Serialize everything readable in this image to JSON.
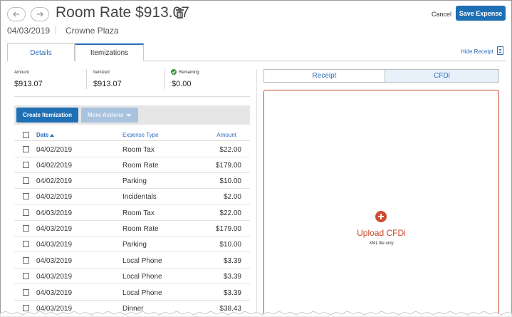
{
  "header": {
    "title": "Room Rate $913.07",
    "date": "04/03/2019",
    "vendor": "Crowne Plaza",
    "cancel_label": "Cancel",
    "save_label": "Save Expense"
  },
  "tabs": [
    {
      "label": "Details",
      "active": false
    },
    {
      "label": "Itemizations",
      "active": true
    }
  ],
  "hide_receipt_label": "Hide Receipt",
  "summary": {
    "amount_label": "Amount",
    "amount_value": "$913.07",
    "itemized_label": "Itemized",
    "itemized_value": "$913.07",
    "remaining_label": "Remaining",
    "remaining_value": "$0.00"
  },
  "toolbar": {
    "create_label": "Create Itemization",
    "more_label": "More Actions"
  },
  "table": {
    "columns": {
      "date": "Date",
      "type": "Expense Type",
      "amount": "Amount"
    },
    "rows": [
      {
        "date": "04/02/2019",
        "type": "Room Tax",
        "amount": "$22.00"
      },
      {
        "date": "04/02/2019",
        "type": "Room Rate",
        "amount": "$179.00"
      },
      {
        "date": "04/02/2019",
        "type": "Parking",
        "amount": "$10.00"
      },
      {
        "date": "04/02/2019",
        "type": "Incidentals",
        "amount": "$2.00"
      },
      {
        "date": "04/03/2019",
        "type": "Room Tax",
        "amount": "$22.00"
      },
      {
        "date": "04/03/2019",
        "type": "Room Rate",
        "amount": "$179.00"
      },
      {
        "date": "04/03/2019",
        "type": "Parking",
        "amount": "$10.00"
      },
      {
        "date": "04/03/2019",
        "type": "Local Phone",
        "amount": "$3.39"
      },
      {
        "date": "04/03/2019",
        "type": "Local Phone",
        "amount": "$3.39"
      },
      {
        "date": "04/03/2019",
        "type": "Local Phone",
        "amount": "$3.39"
      },
      {
        "date": "04/03/2019",
        "type": "Dinner",
        "amount": "$38.43"
      }
    ]
  },
  "receipt_panel": {
    "tabs": [
      {
        "label": "Receipt",
        "active": false
      },
      {
        "label": "CFDi",
        "active": true
      }
    ],
    "upload_label": "Upload CFDi",
    "upload_hint": "XML file only"
  },
  "colors": {
    "primary": "#1f6fb5",
    "link": "#2a6ebb",
    "upload_accent": "#c9452e",
    "success": "#3a9a3a"
  }
}
